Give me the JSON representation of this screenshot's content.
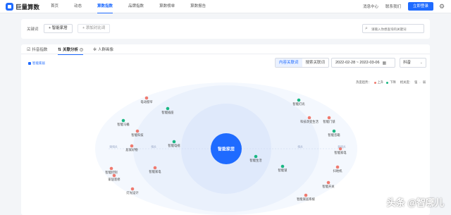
{
  "app": {
    "title": "巨量算数",
    "nav": [
      "首页",
      "动态",
      "算数指数",
      "品牌指数",
      "算数榜单",
      "算数报告"
    ],
    "nav_active_index": 2,
    "top_right": {
      "message": "消息中心",
      "contact": "联系我们",
      "login": "立即登录"
    }
  },
  "keyword_bar": {
    "label": "关键词",
    "tag": "+ 智能家居",
    "add": "+ 添加对比词",
    "search_placeholder": "请输入你想查询的关键词"
  },
  "tabs": [
    {
      "label": "抖音指数",
      "icon": "chart-icon"
    },
    {
      "label": "关联分析",
      "icon": "link-icon"
    },
    {
      "label": "人群画像",
      "icon": "people-icon"
    }
  ],
  "active_tab": 1,
  "toolbar": {
    "keyword_pill": "智能家居",
    "seg_options": [
      "内容关联词",
      "搜索关联词"
    ],
    "seg_active": 0,
    "date_range": "2022-02-28 ~ 2022-03-06",
    "platform": "抖音"
  },
  "legend": {
    "hot_label": "热度趋势：",
    "up": "上升",
    "down": "下降",
    "rel_label": "相关度：",
    "strong": "强",
    "weak": "弱"
  },
  "colors": {
    "accent": "#1f6bff",
    "up": "#ef7a6f",
    "down": "#19b783",
    "ring_inner": "#dfe9fb",
    "ring_mid": "#eaf1fc",
    "ring_outer": "#f4f8fe"
  },
  "graph": {
    "center": "智能家居",
    "ring_labels": [
      "强相关",
      "相关",
      "相关",
      "弱相关"
    ],
    "nodes": [
      {
        "label": "电动窗帘",
        "trend": "up"
      },
      {
        "label": "智能马桶",
        "trend": "down"
      },
      {
        "label": "智能科技",
        "trend": "up"
      },
      {
        "label": "居家好物",
        "trend": "up"
      },
      {
        "label": "智能电视",
        "trend": "down"
      },
      {
        "label": "智能控制",
        "trend": "up"
      },
      {
        "label": "家居装修",
        "trend": "up"
      },
      {
        "label": "智能家电",
        "trend": "up"
      },
      {
        "label": "灯光设计",
        "trend": "up"
      },
      {
        "label": "智能插座",
        "trend": "down"
      },
      {
        "label": "智能灯光",
        "trend": "down"
      },
      {
        "label": "科技改变生活",
        "trend": "up"
      },
      {
        "label": "智能门锁",
        "trend": "up"
      },
      {
        "label": "智能音箱",
        "trend": "down"
      },
      {
        "label": "智能生活",
        "trend": "down"
      },
      {
        "label": "智能家电",
        "trend": "up"
      },
      {
        "label": "智能锁",
        "trend": "down"
      },
      {
        "label": "扫地机",
        "trend": "up"
      },
      {
        "label": "智能开关",
        "trend": "up"
      },
      {
        "label": "智能家居系统",
        "trend": "up"
      }
    ]
  },
  "watermark": "头条 @智哪儿"
}
